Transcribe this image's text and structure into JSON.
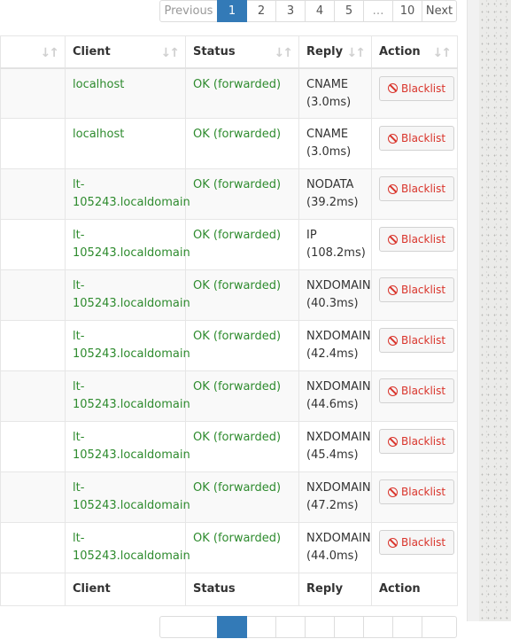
{
  "pagination_top": {
    "previous": "Previous",
    "pages": [
      "1",
      "2",
      "3",
      "4",
      "5",
      "…",
      "10"
    ],
    "next": "Next",
    "active_page": "1"
  },
  "table": {
    "headers": {
      "client": "Client",
      "status": "Status",
      "reply": "Reply",
      "action": "Action"
    },
    "rows": [
      {
        "client_line1": "localhost",
        "client_line2": "",
        "status": "OK (forwarded)",
        "reply_type": "CNAME",
        "reply_time": "(3.0ms)",
        "action": "Blacklist"
      },
      {
        "client_line1": "localhost",
        "client_line2": "",
        "status": "OK (forwarded)",
        "reply_type": "CNAME",
        "reply_time": "(3.0ms)",
        "action": "Blacklist"
      },
      {
        "client_line1": "lt-",
        "client_line2": "105243.localdomain",
        "status": "OK (forwarded)",
        "reply_type": "NODATA",
        "reply_time": "(39.2ms)",
        "action": "Blacklist"
      },
      {
        "client_line1": "lt-",
        "client_line2": "105243.localdomain",
        "status": "OK (forwarded)",
        "reply_type": "IP",
        "reply_time": "(108.2ms)",
        "action": "Blacklist"
      },
      {
        "client_line1": "lt-",
        "client_line2": "105243.localdomain",
        "status": "OK (forwarded)",
        "reply_type": "NXDOMAIN",
        "reply_time": "(40.3ms)",
        "action": "Blacklist"
      },
      {
        "client_line1": "lt-",
        "client_line2": "105243.localdomain",
        "status": "OK (forwarded)",
        "reply_type": "NXDOMAIN",
        "reply_time": "(42.4ms)",
        "action": "Blacklist"
      },
      {
        "client_line1": "lt-",
        "client_line2": "105243.localdomain",
        "status": "OK (forwarded)",
        "reply_type": "NXDOMAIN",
        "reply_time": "(44.6ms)",
        "action": "Blacklist"
      },
      {
        "client_line1": "lt-",
        "client_line2": "105243.localdomain",
        "status": "OK (forwarded)",
        "reply_type": "NXDOMAIN",
        "reply_time": "(45.4ms)",
        "action": "Blacklist"
      },
      {
        "client_line1": "lt-",
        "client_line2": "105243.localdomain",
        "status": "OK (forwarded)",
        "reply_type": "NXDOMAIN",
        "reply_time": "(47.2ms)",
        "action": "Blacklist"
      },
      {
        "client_line1": "lt-",
        "client_line2": "105243.localdomain",
        "status": "OK (forwarded)",
        "reply_type": "NXDOMAIN",
        "reply_time": "(44.0ms)",
        "action": "Blacklist"
      }
    ],
    "footer": {
      "client": "Client",
      "status": "Status",
      "reply": "Reply",
      "action": "Action"
    }
  },
  "colors": {
    "status_ok": "#2e8b2e",
    "active_page": "#337ab7",
    "blacklist": "#d9342b"
  },
  "icons": {
    "sort": "sort-arrows-icon",
    "ban": "ban-icon"
  }
}
